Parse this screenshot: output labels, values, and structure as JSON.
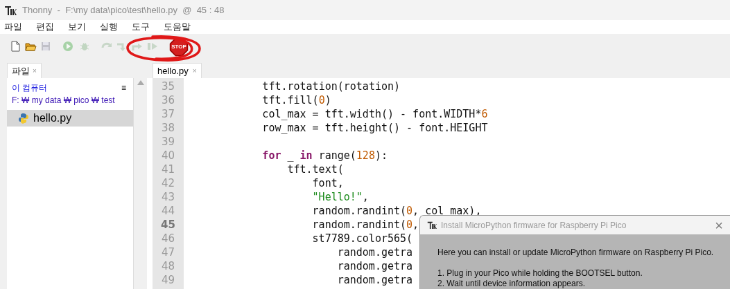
{
  "window": {
    "title": "Thonny  -  F:\\my data\\pico\\test\\hello.py  @  45 : 48"
  },
  "menu": [
    "파일",
    "편집",
    "보기",
    "실행",
    "도구",
    "도움말"
  ],
  "toolbar": [
    {
      "kind": "new",
      "disabled": false
    },
    {
      "kind": "open",
      "disabled": false
    },
    {
      "kind": "save",
      "disabled": true
    },
    {
      "kind": "run",
      "disabled": true
    },
    {
      "kind": "debug",
      "disabled": true
    },
    {
      "kind": "step_over",
      "disabled": true
    },
    {
      "kind": "step_into",
      "disabled": true
    },
    {
      "kind": "step_out",
      "disabled": true
    },
    {
      "kind": "resume",
      "disabled": true
    },
    {
      "kind": "stop",
      "disabled": false,
      "label": "STOP"
    }
  ],
  "files_panel": {
    "tab": {
      "label": "파일",
      "close": "×"
    },
    "location": "이 컴퓨터",
    "menu": "≡",
    "path": "F: ₩ my data ₩ pico ₩ test",
    "items": [
      {
        "name": "hello.py",
        "selected": true
      }
    ]
  },
  "editor": {
    "tab": {
      "label": "hello.py",
      "close": "×"
    },
    "lines": [
      {
        "number": "35",
        "current": false,
        "tokens": [
          {
            "text": "            tft.rotation(rotation)",
            "kind": "plain"
          }
        ]
      },
      {
        "number": "36",
        "current": false,
        "tokens": [
          {
            "text": "            tft.fill(",
            "kind": "plain"
          },
          {
            "text": "0",
            "kind": "number"
          },
          {
            "text": ")",
            "kind": "plain"
          }
        ]
      },
      {
        "number": "37",
        "current": false,
        "tokens": [
          {
            "text": "            col_max = tft.width() - font.WIDTH*",
            "kind": "plain"
          },
          {
            "text": "6",
            "kind": "number"
          }
        ]
      },
      {
        "number": "38",
        "current": false,
        "tokens": [
          {
            "text": "            row_max = tft.height() - font.HEIGHT",
            "kind": "plain"
          }
        ]
      },
      {
        "number": "39",
        "current": false
      },
      {
        "number": "40",
        "current": false,
        "tokens": [
          {
            "text": "            for",
            "kind": "keyword"
          },
          {
            "text": " _ ",
            "kind": "plain"
          },
          {
            "text": "in",
            "kind": "keyword"
          },
          {
            "text": " range(",
            "kind": "plain"
          },
          {
            "text": "128",
            "kind": "number"
          },
          {
            "text": "):",
            "kind": "plain"
          }
        ]
      },
      {
        "number": "41",
        "current": false,
        "tokens": [
          {
            "text": "                tft.text(",
            "kind": "plain"
          }
        ]
      },
      {
        "number": "42",
        "current": false,
        "tokens": [
          {
            "text": "                    font,",
            "kind": "plain"
          }
        ]
      },
      {
        "number": "43",
        "current": false,
        "tokens": [
          {
            "text": "                    \"Hello!\"",
            "kind": "string"
          },
          {
            "text": ",",
            "kind": "plain"
          }
        ]
      },
      {
        "number": "44",
        "current": false,
        "tokens": [
          {
            "text": "                    random.randint(",
            "kind": "plain"
          },
          {
            "text": "0",
            "kind": "number"
          },
          {
            "text": ", col_max),",
            "kind": "plain"
          }
        ]
      },
      {
        "number": "45",
        "current": true,
        "tokens": [
          {
            "text": "                    random.randint(",
            "kind": "plain"
          },
          {
            "text": "0",
            "kind": "number"
          },
          {
            "text": ",",
            "kind": "plain"
          }
        ]
      },
      {
        "number": "46",
        "current": false,
        "tokens": [
          {
            "text": "                    st7789.color565(",
            "kind": "plain"
          }
        ]
      },
      {
        "number": "47",
        "current": false,
        "tokens": [
          {
            "text": "                        random.getra",
            "kind": "plain"
          }
        ]
      },
      {
        "number": "48",
        "current": false,
        "tokens": [
          {
            "text": "                        random.getra",
            "kind": "plain"
          }
        ]
      },
      {
        "number": "49",
        "current": false,
        "tokens": [
          {
            "text": "                        random.getra",
            "kind": "plain"
          }
        ]
      }
    ]
  },
  "dialog": {
    "title": "Install MicroPython firmware for Raspberry Pi Pico",
    "close": "×",
    "paragraphs": [
      "Here you can install or update MicroPython firmware on Raspberry Pi Pico."
    ],
    "steps": [
      "1. Plug in your Pico while holding the BOOTSEL button.",
      "2. Wait until device information appears."
    ]
  }
}
